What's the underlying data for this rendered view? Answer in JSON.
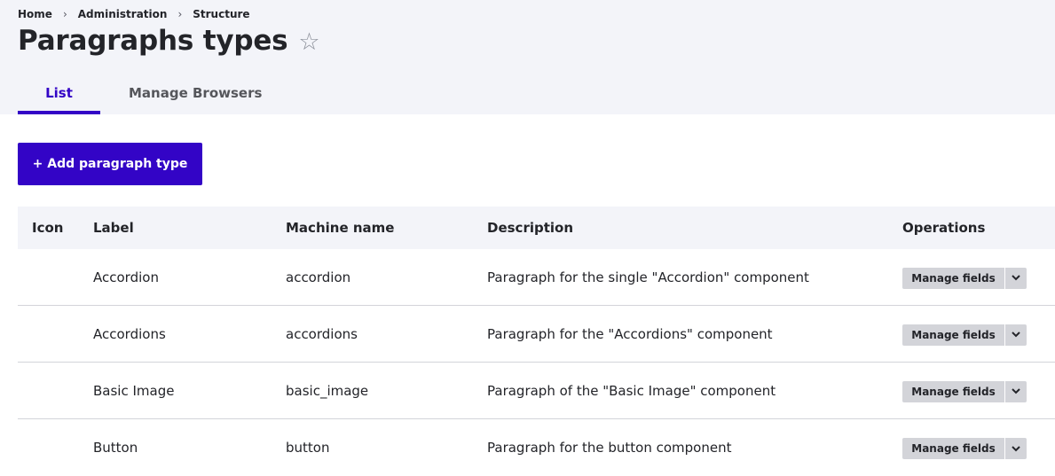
{
  "breadcrumb": [
    {
      "label": "Home"
    },
    {
      "label": "Administration"
    },
    {
      "label": "Structure"
    }
  ],
  "breadcrumb_separator": "›",
  "page_title": "Paragraphs types",
  "star_icon": "☆",
  "tabs": [
    {
      "label": "List",
      "active": true
    },
    {
      "label": "Manage Browsers",
      "active": false
    }
  ],
  "add_button_label": "+ Add paragraph type",
  "accent_color": "#3304c6",
  "table": {
    "headers": {
      "icon": "Icon",
      "label": "Label",
      "machine_name": "Machine name",
      "description": "Description",
      "operations": "Operations"
    },
    "rows": [
      {
        "label": "Accordion",
        "machine_name": "accordion",
        "description": "Paragraph for the single \"Accordion\" component",
        "operation": "Manage fields"
      },
      {
        "label": "Accordions",
        "machine_name": "accordions",
        "description": "Paragraph for the \"Accordions\" component",
        "operation": "Manage fields"
      },
      {
        "label": "Basic Image",
        "machine_name": "basic_image",
        "description": "Paragraph of the \"Basic Image\" component",
        "operation": "Manage fields"
      },
      {
        "label": "Button",
        "machine_name": "button",
        "description": "Paragraph for the button component",
        "operation": "Manage fields"
      }
    ]
  }
}
